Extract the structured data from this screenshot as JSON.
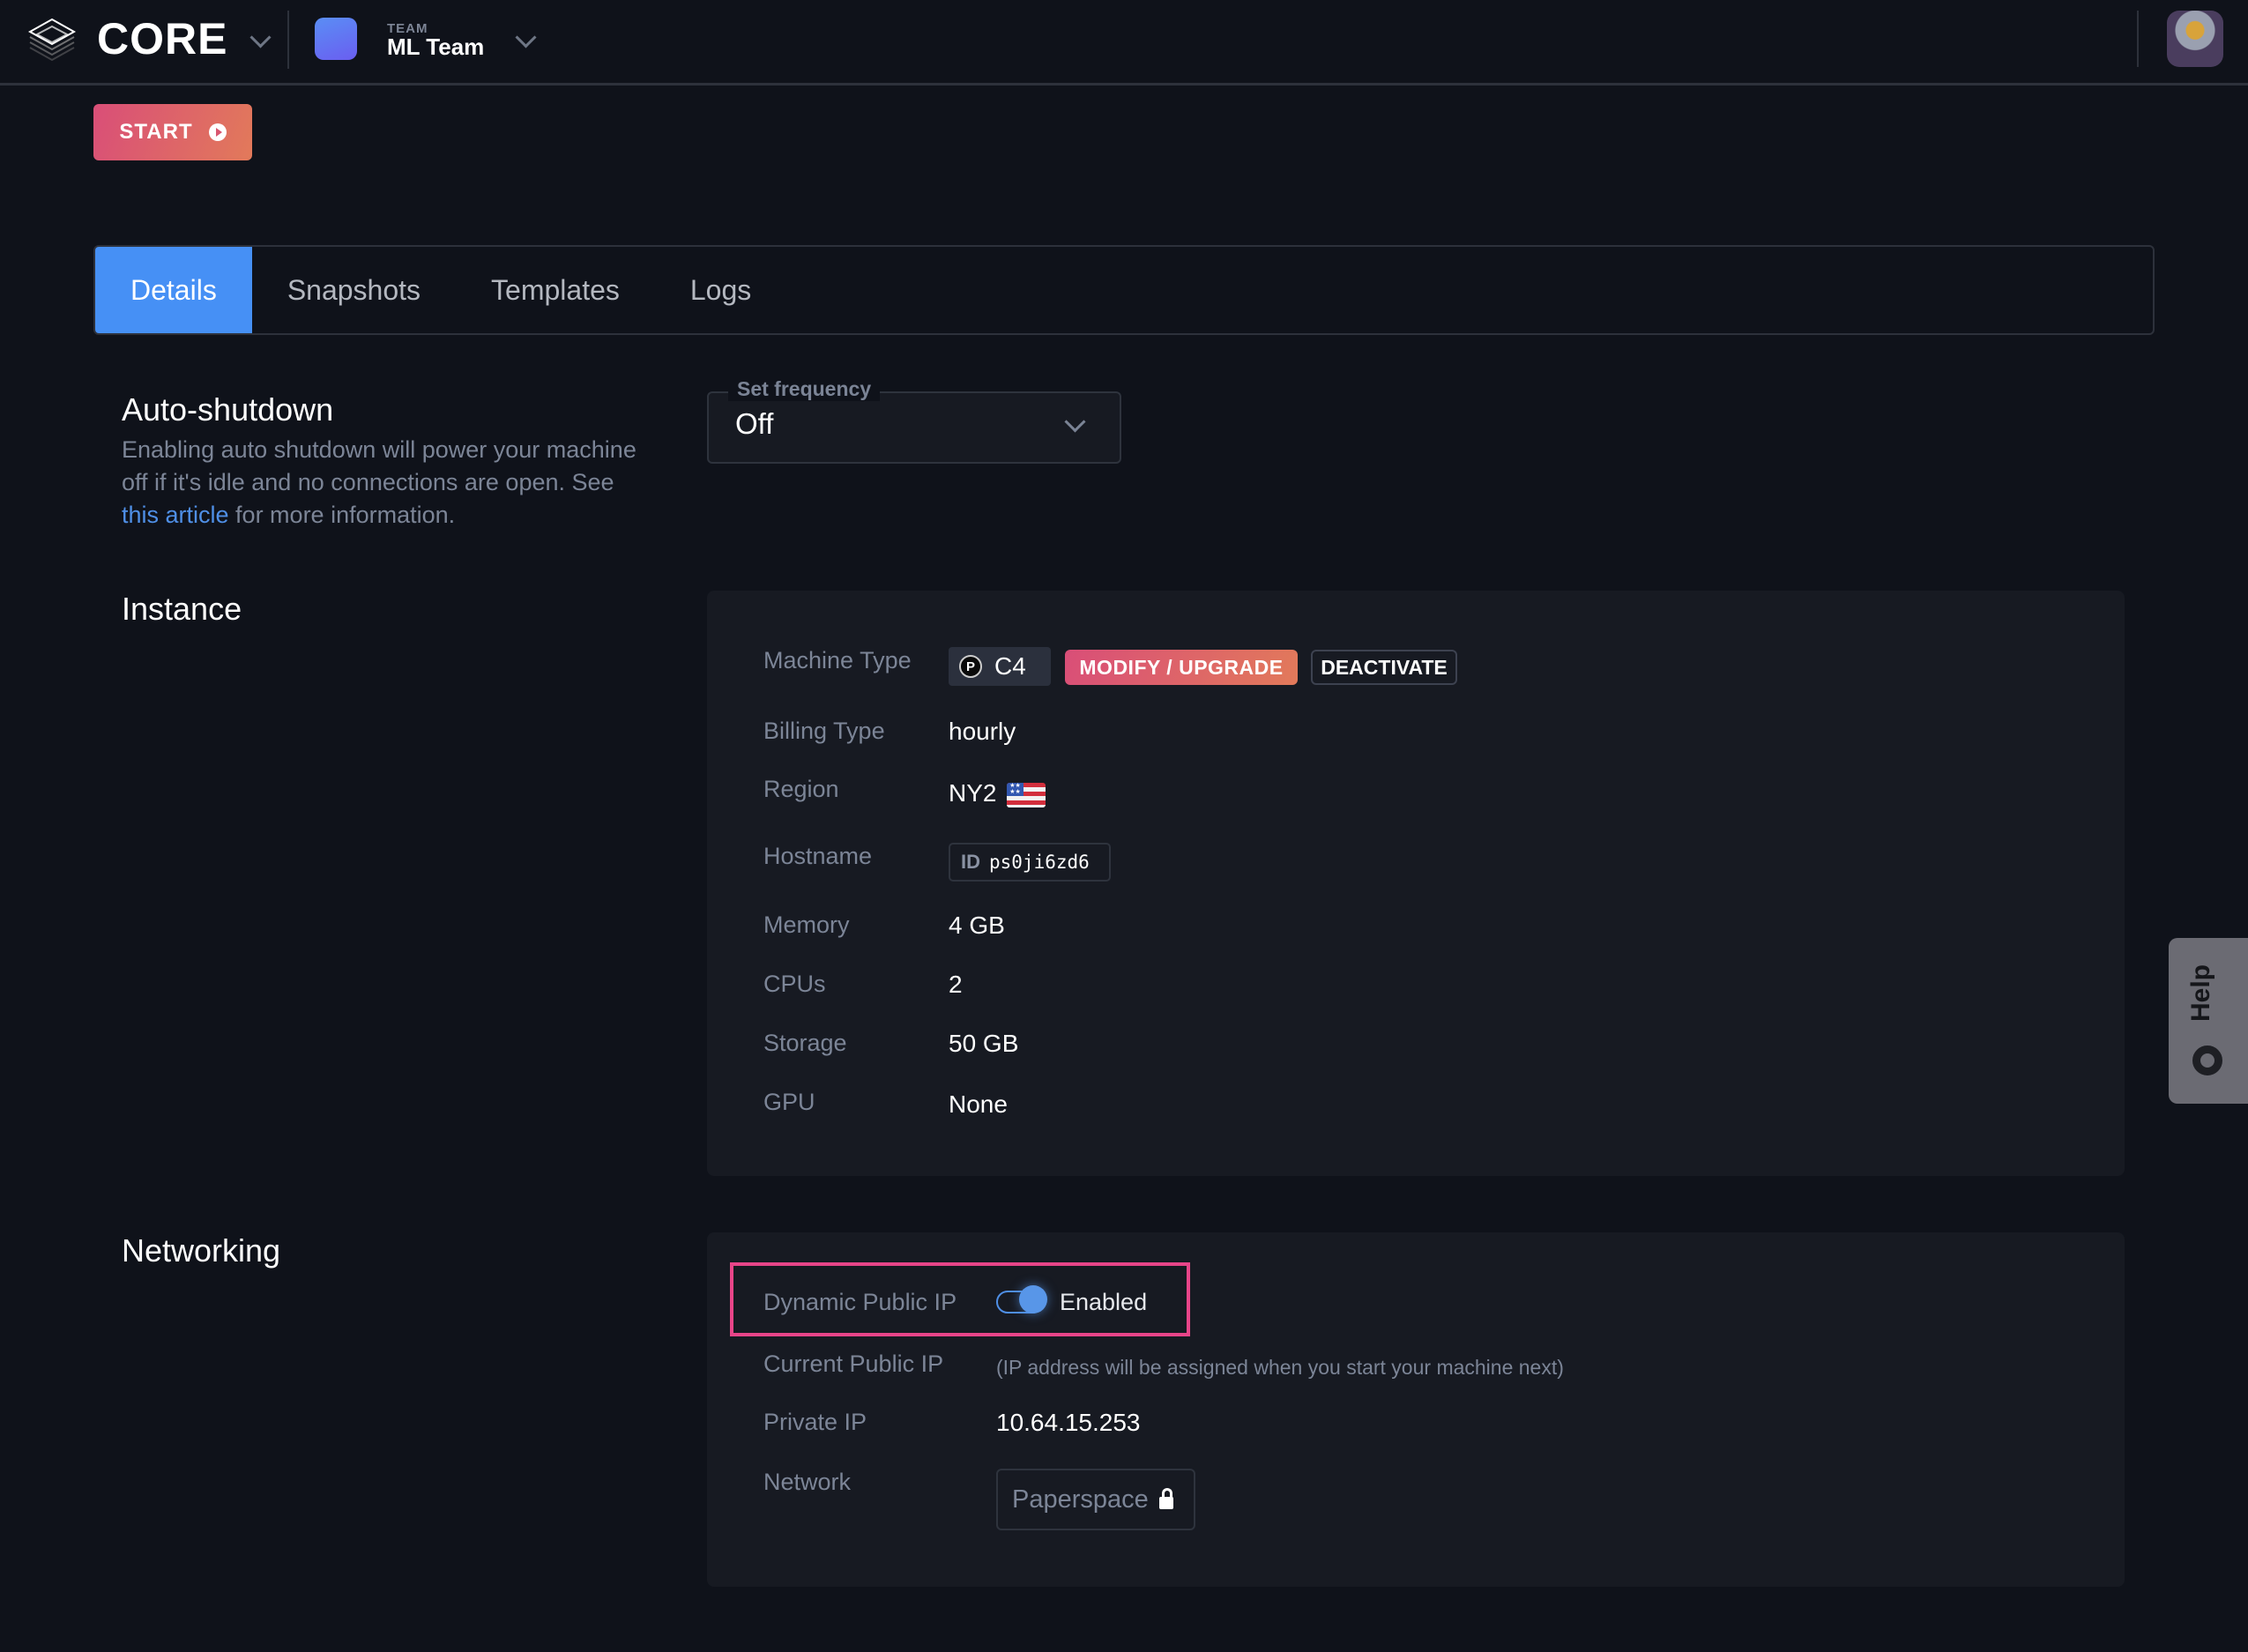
{
  "header": {
    "brand": "CORE",
    "team_label": "TEAM",
    "team_name": "ML Team"
  },
  "actions": {
    "start_label": "START"
  },
  "tabs": [
    {
      "label": "Details",
      "active": true
    },
    {
      "label": "Snapshots",
      "active": false
    },
    {
      "label": "Templates",
      "active": false
    },
    {
      "label": "Logs",
      "active": false
    }
  ],
  "auto_shutdown": {
    "title": "Auto-shutdown",
    "desc_before": "Enabling auto shutdown will power your machine off if it's idle and no connections are open. See ",
    "link_text": "this article",
    "desc_after": " for more information.",
    "select_label": "Set frequency",
    "select_value": "Off"
  },
  "instance": {
    "title": "Instance",
    "machine_type_label": "Machine Type",
    "machine_type_value": "C4",
    "machine_icon_glyph": "P",
    "modify_label": "MODIFY / UPGRADE",
    "deactivate_label": "DEACTIVATE",
    "billing_label": "Billing Type",
    "billing_value": "hourly",
    "region_label": "Region",
    "region_value": "NY2",
    "hostname_label": "Hostname",
    "hostname_prefix": "ID",
    "hostname_value": "ps0ji6zd6",
    "memory_label": "Memory",
    "memory_value": "4 GB",
    "cpus_label": "CPUs",
    "cpus_value": "2",
    "storage_label": "Storage",
    "storage_value": "50 GB",
    "gpu_label": "GPU",
    "gpu_value": "None"
  },
  "networking": {
    "title": "Networking",
    "dynamic_ip_label": "Dynamic Public IP",
    "dynamic_ip_state": "Enabled",
    "dynamic_ip_enabled": true,
    "public_ip_label": "Current Public IP",
    "public_ip_value": "(IP address will be assigned when you start your machine next)",
    "private_ip_label": "Private IP",
    "private_ip_value": "10.64.15.253",
    "network_label": "Network",
    "network_value": "Paperspace"
  },
  "help": {
    "label": "Help"
  },
  "colors": {
    "accent": "#4690f5",
    "gradient_start": "#d94e78",
    "gradient_end": "#e27a5a",
    "highlight": "#e84589"
  }
}
